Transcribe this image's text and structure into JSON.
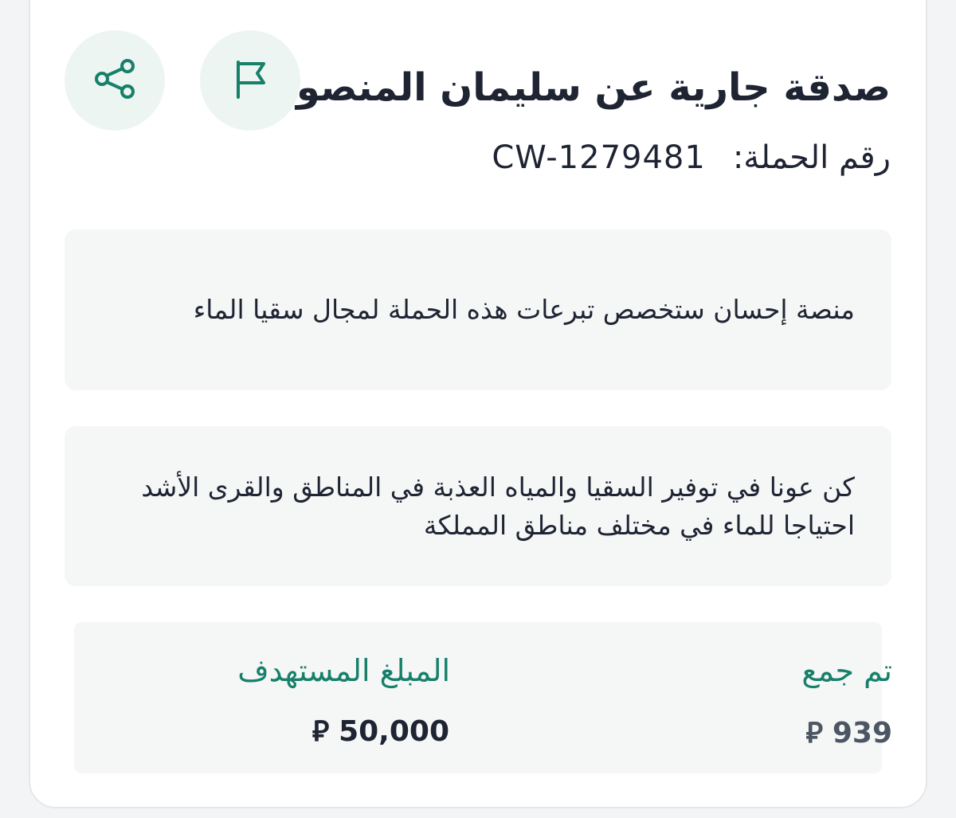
{
  "campaign": {
    "title": "صدقة جارية عن سليمان المنصور",
    "number_label": "رقم الحملة:",
    "number": "CW-1279481",
    "note": "منصة إحسان ستخصص تبرعات هذه الحملة لمجال سقيا الماء",
    "description": "كن عونا في توفير السقيا والمياه العذبة في المناطق والقرى الأشد احتياجا للماء في مختلف مناطق المملكة"
  },
  "actions": {
    "flag_icon": "flag-icon",
    "share_icon": "share-icon"
  },
  "stats": {
    "collected_label": "تم جمع",
    "collected_value": "939",
    "target_label": "المبلغ المستهدف",
    "target_value": "50,000",
    "currency_symbol": "⃁"
  },
  "colors": {
    "accent": "#16806a",
    "icon_bg": "#edf5f2",
    "box_bg": "#f5f6f6",
    "text": "#1f2433"
  }
}
